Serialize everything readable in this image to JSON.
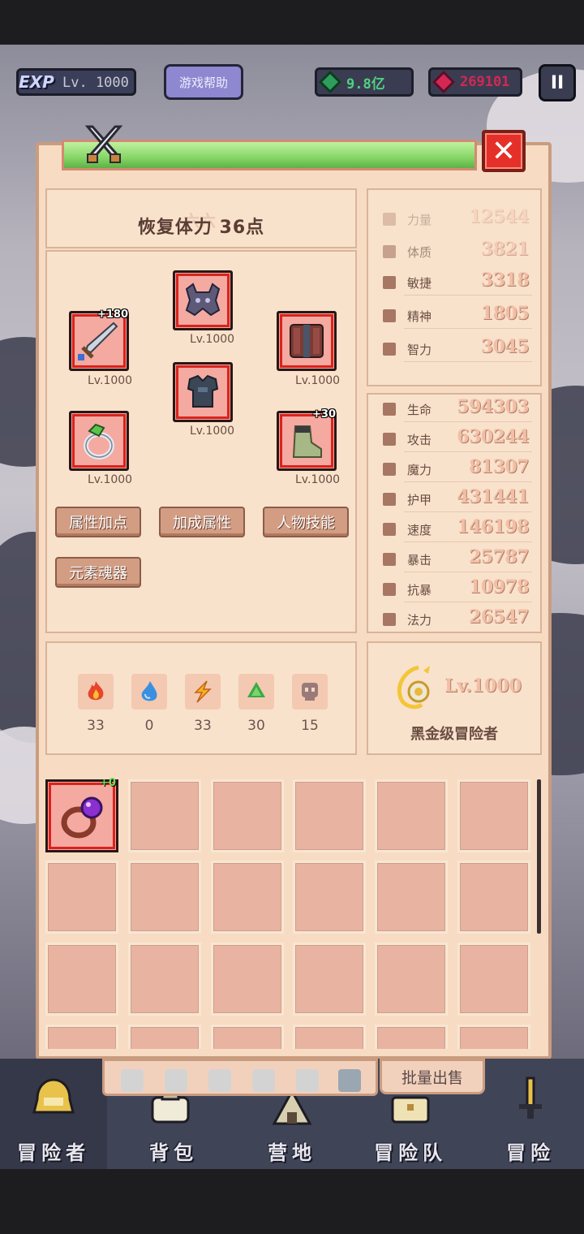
{
  "top_bar": {
    "exp_tag": "EXP",
    "level": "Lv. 1000",
    "help_label": "游戏帮助",
    "currency_green": "9.8亿",
    "currency_red": "269101",
    "pause_label": "II"
  },
  "panel": {
    "close_label": "✕",
    "recover_text": "恢复体力 36点",
    "faded_title": "六六"
  },
  "equipment": {
    "slots": [
      {
        "item": "helmet",
        "level": "Lv.1000",
        "plus": ""
      },
      {
        "item": "sword",
        "level": "Lv.1000",
        "plus": "+180"
      },
      {
        "item": "shield",
        "level": "Lv.1000",
        "plus": ""
      },
      {
        "item": "armor",
        "level": "Lv.1000",
        "plus": ""
      },
      {
        "item": "ring",
        "level": "Lv.1000",
        "plus": ""
      },
      {
        "item": "boots",
        "level": "Lv.1000",
        "plus": "+30"
      }
    ],
    "buttons": [
      "属性加点",
      "加成属性",
      "人物技能",
      "元素魂器"
    ]
  },
  "elements": [
    {
      "name": "fire",
      "value": "33",
      "color": "#e8452b"
    },
    {
      "name": "water",
      "value": "0",
      "color": "#3b8fe0"
    },
    {
      "name": "lightning",
      "value": "33",
      "color": "#f5b21a"
    },
    {
      "name": "earth",
      "value": "30",
      "color": "#39a94a"
    },
    {
      "name": "dark",
      "value": "15",
      "color": "#9a7a78"
    }
  ],
  "base_stats": [
    {
      "name": "力量",
      "value": "12544"
    },
    {
      "name": "体质",
      "value": "3821"
    },
    {
      "name": "敏捷",
      "value": "3318"
    },
    {
      "name": "精神",
      "value": "1805"
    },
    {
      "name": "智力",
      "value": "3045"
    }
  ],
  "combat_stats": [
    {
      "name": "生命",
      "value": "594303"
    },
    {
      "name": "攻击",
      "value": "630244"
    },
    {
      "name": "魔力",
      "value": "81307"
    },
    {
      "name": "护甲",
      "value": "431441"
    },
    {
      "name": "速度",
      "value": "146198"
    },
    {
      "name": "暴击",
      "value": "25787"
    },
    {
      "name": "抗暴",
      "value": "10978"
    },
    {
      "name": "法力",
      "value": "26547"
    }
  ],
  "rank": {
    "level": "Lv.1000",
    "title": "黑金级冒险者"
  },
  "inventory": {
    "first_item": "ring",
    "first_item_plus": "+0"
  },
  "tabs": {
    "sell_label": "批量出售"
  },
  "bottom_nav": [
    {
      "label": "冒险者"
    },
    {
      "label": "背包"
    },
    {
      "label": "营地"
    },
    {
      "label": "冒险队"
    },
    {
      "label": "冒险"
    }
  ]
}
